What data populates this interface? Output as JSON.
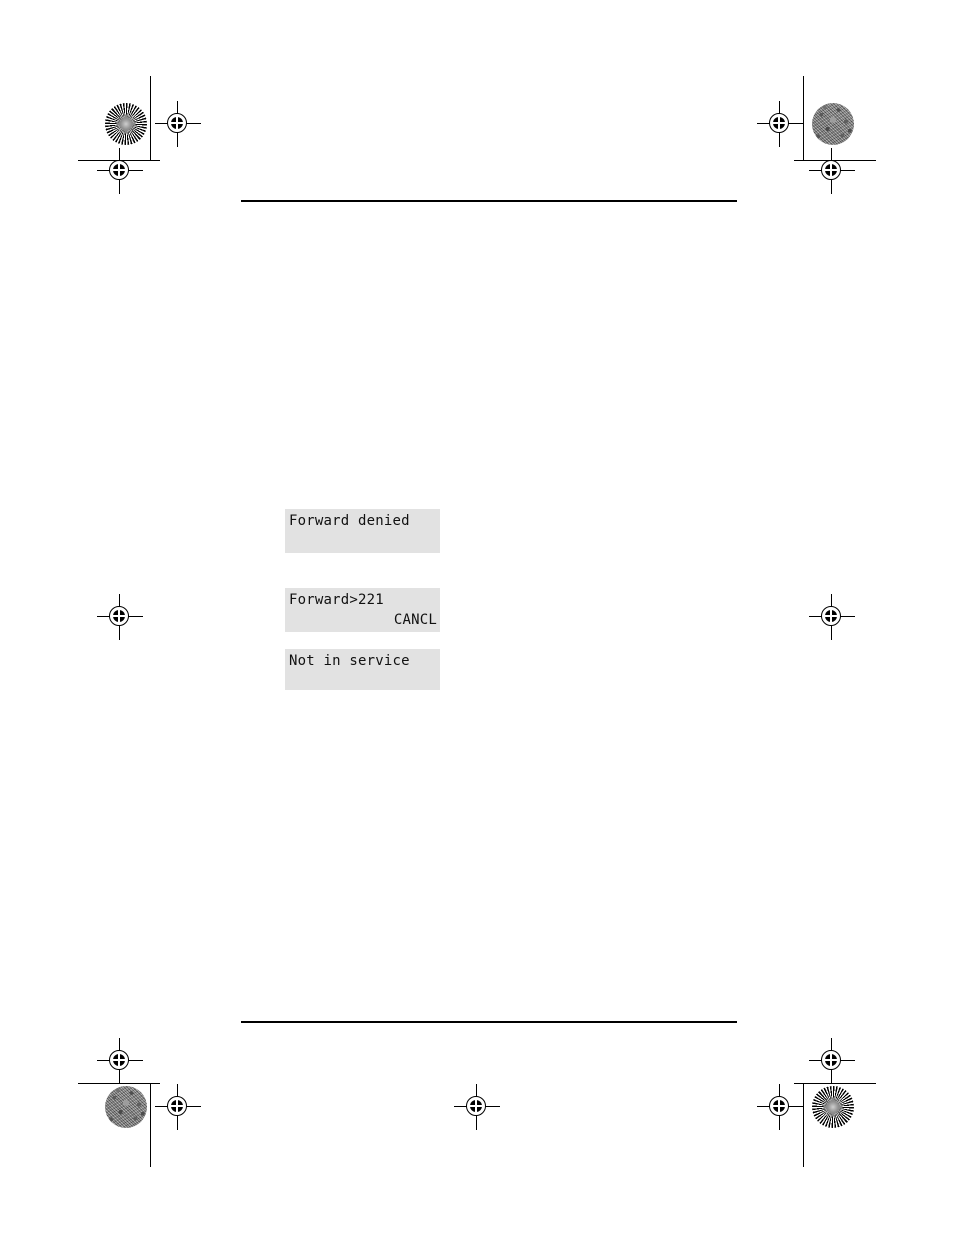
{
  "document": {
    "page_background": "#ffffff",
    "rule_color": "#000000",
    "lcd_background": "#e2e2e2",
    "lcd_text_color": "#111111"
  },
  "rules": [
    {
      "name": "top-rule"
    },
    {
      "name": "bottom-rule"
    }
  ],
  "displays": [
    {
      "id": "forward-denied",
      "name": "lcd-display-forward-denied",
      "line1": "Forward denied",
      "line2": ""
    },
    {
      "id": "forward-221",
      "name": "lcd-display-forward-221",
      "line1": "Forward>221",
      "line2": "CANCL"
    },
    {
      "id": "not-in-service",
      "name": "lcd-display-not-in-service",
      "line1": "Not in service",
      "line2": ""
    }
  ],
  "print_marks": {
    "starburst_label": "starburst-density-patch",
    "tint_label": "halftone-tint-patch",
    "target_label": "registration-target",
    "crop_label": "crop-mark"
  }
}
